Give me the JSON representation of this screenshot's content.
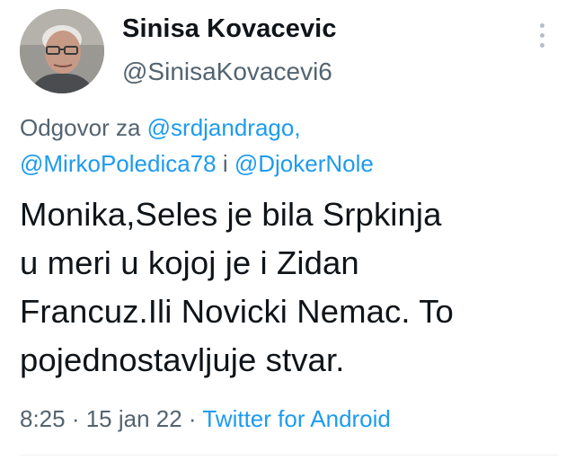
{
  "author": {
    "display_name": "Sinisa Kovacevic",
    "handle": "@SinisaKovacevi6",
    "avatar_icon": "profile-photo"
  },
  "more_icon": "more-vertical-icon",
  "reply_context": {
    "prefix": "Odgovor za ",
    "mention_1": "@srdjandrago,",
    "mention_2": "@MirkoPoledica78",
    "conjunction": " i ",
    "mention_3": "@DjokerNole"
  },
  "tweet": {
    "lines": [
      "Monika,Seles je bila Srpkinja",
      "u meri u kojoj je i Zidan",
      "Francuz.Ili Novicki Nemac. To",
      "pojednostavljuje stvar."
    ]
  },
  "meta": {
    "time": "8:25",
    "separator_1": " · ",
    "date": "15 jan 22",
    "separator_2": " · ",
    "source": "Twitter for Android"
  },
  "colors": {
    "text": "#0f1419",
    "secondary": "#536471",
    "link": "#1d9bf0"
  }
}
